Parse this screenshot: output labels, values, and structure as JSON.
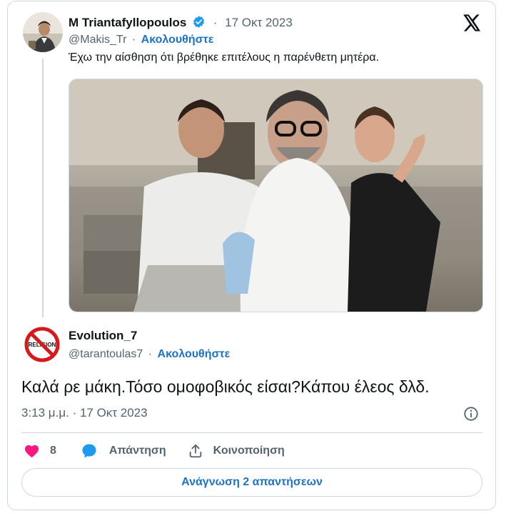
{
  "quoted_tweet": {
    "author_name": "M Triantafyllopoulos",
    "date": "17 Οκτ 2023",
    "handle": "@Makis_Tr",
    "follow_label": "Ακολουθήστε",
    "text": "Έχω την αίσθηση ότι βρέθηκε επιτέλους η παρένθετη μητέρα.",
    "verified": true
  },
  "reply_tweet": {
    "author_name": "Evolution_7",
    "handle": "@tarantoulas7",
    "follow_label": "Ακολουθήστε",
    "avatar_text": "RELIGION",
    "text": "Καλά ρε μάκη.Τόσο ομοφοβικός είσαι?Κάπου έλεος δλδ.",
    "timestamp": "3:13 μ.μ. · 17 Οκτ 2023"
  },
  "actions": {
    "like_count": "8",
    "reply_label": "Απάντηση",
    "share_label": "Κοινοποίηση"
  },
  "read_replies_label": "Ανάγνωση 2 απαντήσεων",
  "separator": "·",
  "colors": {
    "accent": "#1d72c9",
    "like": "#f91880",
    "verified": "#1d9bf0"
  },
  "icons": [
    "x-logo-icon",
    "verified-badge-icon",
    "heart-icon",
    "reply-icon",
    "share-icon",
    "info-icon"
  ]
}
